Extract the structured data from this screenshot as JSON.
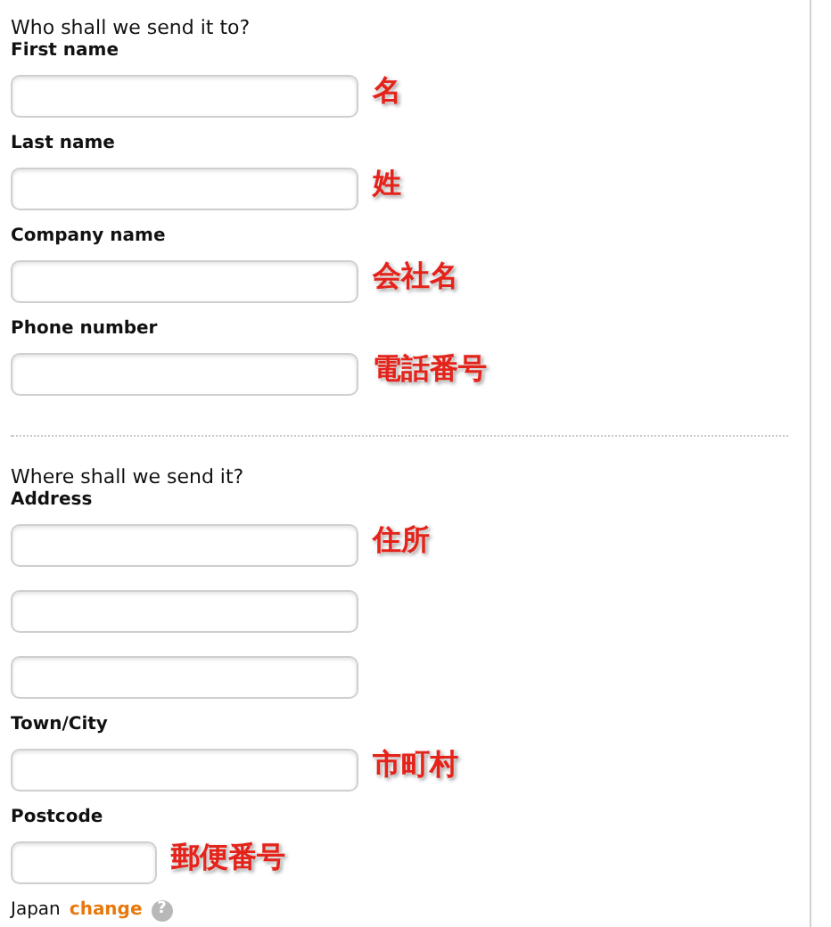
{
  "sections": [
    {
      "heading": "Who shall we send it to?",
      "fields": [
        {
          "label": "First name",
          "kind": "wide",
          "note": "名"
        },
        {
          "label": "Last name",
          "kind": "wide",
          "note": "姓"
        },
        {
          "label": "Company name",
          "kind": "wide",
          "note": "会社名"
        },
        {
          "label": "Phone number",
          "kind": "wide",
          "note": "電話番号"
        }
      ]
    },
    {
      "heading": "Where shall we send it?",
      "fields": [
        {
          "label": "Address",
          "kind": "wide",
          "note": "住所"
        },
        {
          "kind": "wide"
        },
        {
          "kind": "wide"
        },
        {
          "label": "Town/City",
          "kind": "wide",
          "note": "市町村"
        },
        {
          "label": "Postcode",
          "kind": "short",
          "note": "郵便番号"
        }
      ]
    }
  ],
  "country": {
    "name": "Japan",
    "link": "change",
    "help": "?"
  }
}
